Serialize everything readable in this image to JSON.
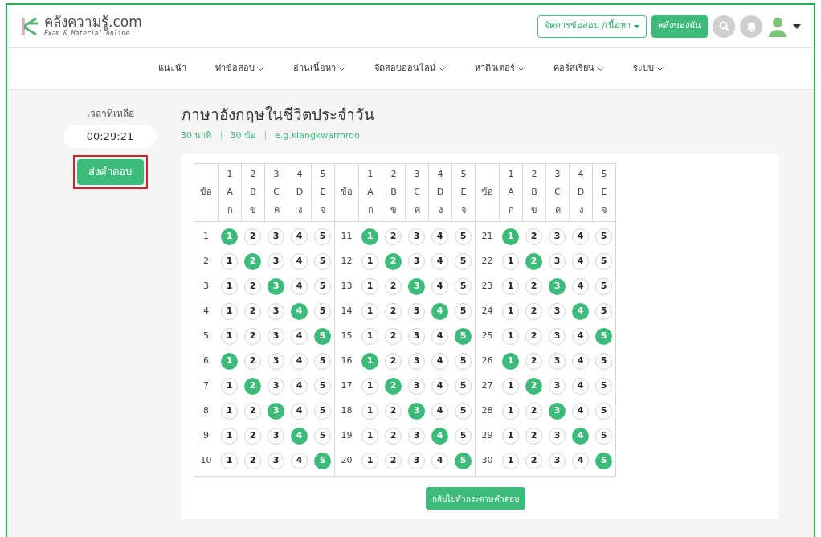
{
  "header": {
    "logo_title": "คลังความรู้.com",
    "logo_subtitle": "Exam & Material online",
    "manage_button": "จัดการข้อสอบ /เนื้อหา",
    "library_button": "คลังของฉัน"
  },
  "nav": [
    {
      "label": "แนะนำ",
      "dropdown": false
    },
    {
      "label": "ทำข้อสอบ",
      "dropdown": true
    },
    {
      "label": "อ่านเนื้อหา",
      "dropdown": true
    },
    {
      "label": "จัดสอบออนไลน์",
      "dropdown": true
    },
    {
      "label": "หาติวเตอร์",
      "dropdown": true
    },
    {
      "label": "คอร์สเรียน",
      "dropdown": true
    },
    {
      "label": "ระบบ",
      "dropdown": true
    }
  ],
  "timer": {
    "label": "เวลาที่เหลือ",
    "value": "00:29:21"
  },
  "submit_button": {
    "label": "ส่งคำตอบ",
    "highlighted": true
  },
  "exam": {
    "title": "ภาษาอังกฤษในชีวิตประจำวัน",
    "meta": [
      "30 นาที",
      "30 ข้อ",
      "e.g.klangkwarmroo"
    ]
  },
  "answer_sheet": {
    "blocks": [
      {
        "header_label": "ข้อ",
        "columns": [
          {
            "number": "1",
            "letter": "A",
            "thai": "ก"
          },
          {
            "number": "2",
            "letter": "B",
            "thai": "ข"
          },
          {
            "number": "3",
            "letter": "C",
            "thai": "ค"
          },
          {
            "number": "4",
            "letter": "D",
            "thai": "ง"
          },
          {
            "number": "5",
            "letter": "E",
            "thai": "จ"
          }
        ],
        "rows": [
          {
            "number": "1",
            "options": [
              {
                "label": "1",
                "selected": true
              },
              {
                "label": "2",
                "selected": false
              },
              {
                "label": "3",
                "selected": false
              },
              {
                "label": "4",
                "selected": false
              },
              {
                "label": "5",
                "selected": false
              }
            ]
          },
          {
            "number": "2",
            "options": [
              {
                "label": "1",
                "selected": false
              },
              {
                "label": "2",
                "selected": true
              },
              {
                "label": "3",
                "selected": false
              },
              {
                "label": "4",
                "selected": false
              },
              {
                "label": "5",
                "selected": false
              }
            ]
          },
          {
            "number": "3",
            "options": [
              {
                "label": "1",
                "selected": false
              },
              {
                "label": "2",
                "selected": false
              },
              {
                "label": "3",
                "selected": true
              },
              {
                "label": "4",
                "selected": false
              },
              {
                "label": "5",
                "selected": false
              }
            ]
          },
          {
            "number": "4",
            "options": [
              {
                "label": "1",
                "selected": false
              },
              {
                "label": "2",
                "selected": false
              },
              {
                "label": "3",
                "selected": false
              },
              {
                "label": "4",
                "selected": true
              },
              {
                "label": "5",
                "selected": false
              }
            ]
          },
          {
            "number": "5",
            "options": [
              {
                "label": "1",
                "selected": false
              },
              {
                "label": "2",
                "selected": false
              },
              {
                "label": "3",
                "selected": false
              },
              {
                "label": "4",
                "selected": false
              },
              {
                "label": "5",
                "selected": true
              }
            ]
          },
          {
            "number": "6",
            "options": [
              {
                "label": "1",
                "selected": true
              },
              {
                "label": "2",
                "selected": false
              },
              {
                "label": "3",
                "selected": false
              },
              {
                "label": "4",
                "selected": false
              },
              {
                "label": "5",
                "selected": false
              }
            ]
          },
          {
            "number": "7",
            "options": [
              {
                "label": "1",
                "selected": false
              },
              {
                "label": "2",
                "selected": true
              },
              {
                "label": "3",
                "selected": false
              },
              {
                "label": "4",
                "selected": false
              },
              {
                "label": "5",
                "selected": false
              }
            ]
          },
          {
            "number": "8",
            "options": [
              {
                "label": "1",
                "selected": false
              },
              {
                "label": "2",
                "selected": false
              },
              {
                "label": "3",
                "selected": true
              },
              {
                "label": "4",
                "selected": false
              },
              {
                "label": "5",
                "selected": false
              }
            ]
          },
          {
            "number": "9",
            "options": [
              {
                "label": "1",
                "selected": false
              },
              {
                "label": "2",
                "selected": false
              },
              {
                "label": "3",
                "selected": false
              },
              {
                "label": "4",
                "selected": true
              },
              {
                "label": "5",
                "selected": false
              }
            ]
          },
          {
            "number": "10",
            "options": [
              {
                "label": "1",
                "selected": false
              },
              {
                "label": "2",
                "selected": false
              },
              {
                "label": "3",
                "selected": false
              },
              {
                "label": "4",
                "selected": false
              },
              {
                "label": "5",
                "selected": true
              }
            ]
          }
        ]
      },
      {
        "header_label": "ข้อ",
        "columns": [
          {
            "number": "1",
            "letter": "A",
            "thai": "ก"
          },
          {
            "number": "2",
            "letter": "B",
            "thai": "ข"
          },
          {
            "number": "3",
            "letter": "C",
            "thai": "ค"
          },
          {
            "number": "4",
            "letter": "D",
            "thai": "ง"
          },
          {
            "number": "5",
            "letter": "E",
            "thai": "จ"
          }
        ],
        "rows": [
          {
            "number": "11",
            "options": [
              {
                "label": "1",
                "selected": true
              },
              {
                "label": "2",
                "selected": false
              },
              {
                "label": "3",
                "selected": false
              },
              {
                "label": "4",
                "selected": false
              },
              {
                "label": "5",
                "selected": false
              }
            ]
          },
          {
            "number": "12",
            "options": [
              {
                "label": "1",
                "selected": false
              },
              {
                "label": "2",
                "selected": true
              },
              {
                "label": "3",
                "selected": false
              },
              {
                "label": "4",
                "selected": false
              },
              {
                "label": "5",
                "selected": false
              }
            ]
          },
          {
            "number": "13",
            "options": [
              {
                "label": "1",
                "selected": false
              },
              {
                "label": "2",
                "selected": false
              },
              {
                "label": "3",
                "selected": true
              },
              {
                "label": "4",
                "selected": false
              },
              {
                "label": "5",
                "selected": false
              }
            ]
          },
          {
            "number": "14",
            "options": [
              {
                "label": "1",
                "selected": false
              },
              {
                "label": "2",
                "selected": false
              },
              {
                "label": "3",
                "selected": false
              },
              {
                "label": "4",
                "selected": true
              },
              {
                "label": "5",
                "selected": false
              }
            ]
          },
          {
            "number": "15",
            "options": [
              {
                "label": "1",
                "selected": false
              },
              {
                "label": "2",
                "selected": false
              },
              {
                "label": "3",
                "selected": false
              },
              {
                "label": "4",
                "selected": false
              },
              {
                "label": "5",
                "selected": true
              }
            ]
          },
          {
            "number": "16",
            "options": [
              {
                "label": "1",
                "selected": true
              },
              {
                "label": "2",
                "selected": false
              },
              {
                "label": "3",
                "selected": false
              },
              {
                "label": "4",
                "selected": false
              },
              {
                "label": "5",
                "selected": false
              }
            ]
          },
          {
            "number": "17",
            "options": [
              {
                "label": "1",
                "selected": false
              },
              {
                "label": "2",
                "selected": true
              },
              {
                "label": "3",
                "selected": false
              },
              {
                "label": "4",
                "selected": false
              },
              {
                "label": "5",
                "selected": false
              }
            ]
          },
          {
            "number": "18",
            "options": [
              {
                "label": "1",
                "selected": false
              },
              {
                "label": "2",
                "selected": false
              },
              {
                "label": "3",
                "selected": true
              },
              {
                "label": "4",
                "selected": false
              },
              {
                "label": "5",
                "selected": false
              }
            ]
          },
          {
            "number": "19",
            "options": [
              {
                "label": "1",
                "selected": false
              },
              {
                "label": "2",
                "selected": false
              },
              {
                "label": "3",
                "selected": false
              },
              {
                "label": "4",
                "selected": true
              },
              {
                "label": "5",
                "selected": false
              }
            ]
          },
          {
            "number": "20",
            "options": [
              {
                "label": "1",
                "selected": false
              },
              {
                "label": "2",
                "selected": false
              },
              {
                "label": "3",
                "selected": false
              },
              {
                "label": "4",
                "selected": false
              },
              {
                "label": "5",
                "selected": true
              }
            ]
          }
        ]
      },
      {
        "header_label": "ข้อ",
        "columns": [
          {
            "number": "1",
            "letter": "A",
            "thai": "ก"
          },
          {
            "number": "2",
            "letter": "B",
            "thai": "ข"
          },
          {
            "number": "3",
            "letter": "C",
            "thai": "ค"
          },
          {
            "number": "4",
            "letter": "D",
            "thai": "ง"
          },
          {
            "number": "5",
            "letter": "E",
            "thai": "จ"
          }
        ],
        "rows": [
          {
            "number": "21",
            "options": [
              {
                "label": "1",
                "selected": true
              },
              {
                "label": "2",
                "selected": false
              },
              {
                "label": "3",
                "selected": false
              },
              {
                "label": "4",
                "selected": false
              },
              {
                "label": "5",
                "selected": false
              }
            ]
          },
          {
            "number": "22",
            "options": [
              {
                "label": "1",
                "selected": false
              },
              {
                "label": "2",
                "selected": true
              },
              {
                "label": "3",
                "selected": false
              },
              {
                "label": "4",
                "selected": false
              },
              {
                "label": "5",
                "selected": false
              }
            ]
          },
          {
            "number": "23",
            "options": [
              {
                "label": "1",
                "selected": false
              },
              {
                "label": "2",
                "selected": false
              },
              {
                "label": "3",
                "selected": true
              },
              {
                "label": "4",
                "selected": false
              },
              {
                "label": "5",
                "selected": false
              }
            ]
          },
          {
            "number": "24",
            "options": [
              {
                "label": "1",
                "selected": false
              },
              {
                "label": "2",
                "selected": false
              },
              {
                "label": "3",
                "selected": false
              },
              {
                "label": "4",
                "selected": true
              },
              {
                "label": "5",
                "selected": false
              }
            ]
          },
          {
            "number": "25",
            "options": [
              {
                "label": "1",
                "selected": false
              },
              {
                "label": "2",
                "selected": false
              },
              {
                "label": "3",
                "selected": false
              },
              {
                "label": "4",
                "selected": false
              },
              {
                "label": "5",
                "selected": true
              }
            ]
          },
          {
            "number": "26",
            "options": [
              {
                "label": "1",
                "selected": true
              },
              {
                "label": "2",
                "selected": false
              },
              {
                "label": "3",
                "selected": false
              },
              {
                "label": "4",
                "selected": false
              },
              {
                "label": "5",
                "selected": false
              }
            ]
          },
          {
            "number": "27",
            "options": [
              {
                "label": "1",
                "selected": false
              },
              {
                "label": "2",
                "selected": true
              },
              {
                "label": "3",
                "selected": false
              },
              {
                "label": "4",
                "selected": false
              },
              {
                "label": "5",
                "selected": false
              }
            ]
          },
          {
            "number": "28",
            "options": [
              {
                "label": "1",
                "selected": false
              },
              {
                "label": "2",
                "selected": false
              },
              {
                "label": "3",
                "selected": true
              },
              {
                "label": "4",
                "selected": false
              },
              {
                "label": "5",
                "selected": false
              }
            ]
          },
          {
            "number": "29",
            "options": [
              {
                "label": "1",
                "selected": false
              },
              {
                "label": "2",
                "selected": false
              },
              {
                "label": "3",
                "selected": false
              },
              {
                "label": "4",
                "selected": true
              },
              {
                "label": "5",
                "selected": false
              }
            ]
          },
          {
            "number": "30",
            "options": [
              {
                "label": "1",
                "selected": false
              },
              {
                "label": "2",
                "selected": false
              },
              {
                "label": "3",
                "selected": false
              },
              {
                "label": "4",
                "selected": false
              },
              {
                "label": "5",
                "selected": true
              }
            ]
          }
        ]
      }
    ],
    "back_button": "กลับไปหัวกระดาษคำตอบ"
  }
}
